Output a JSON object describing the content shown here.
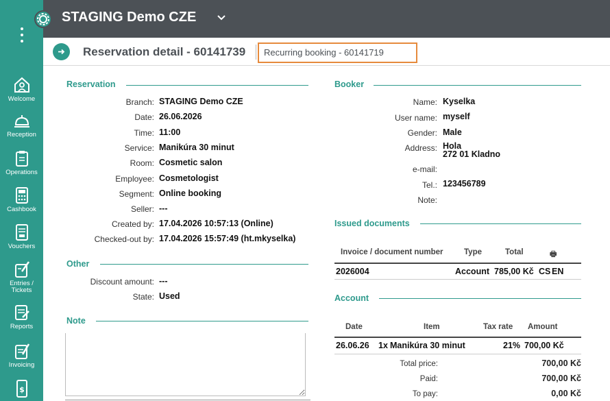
{
  "app": {
    "org_name": "STAGING Demo CZE"
  },
  "sidebar": {
    "items": [
      {
        "label": "Welcome",
        "icon": "house-person-icon"
      },
      {
        "label": "Reception",
        "icon": "reception-bell-icon"
      },
      {
        "label": "Operations",
        "icon": "clipboard-icon"
      },
      {
        "label": "Cashbook",
        "icon": "calculator-icon"
      },
      {
        "label": "Vouchers",
        "icon": "voucher-icon"
      },
      {
        "label": "Entries / Tickets",
        "icon": "ticket-icon"
      },
      {
        "label": "Reports",
        "icon": "report-icon"
      },
      {
        "label": "Invoicing",
        "icon": "invoice-icon"
      },
      {
        "label": "",
        "icon": "dollar-phone-icon"
      }
    ]
  },
  "header": {
    "page_title": "Reservation detail - 60141739",
    "recurring_booking": "Recurring booking - 60141719"
  },
  "reservation": {
    "title": "Reservation",
    "fields": [
      {
        "label": "Branch:",
        "value": "STAGING Demo CZE"
      },
      {
        "label": "Date:",
        "value": "26.06.2026"
      },
      {
        "label": "Time:",
        "value": "11:00"
      },
      {
        "label": "Service:",
        "value": "Manikúra 30 minut"
      },
      {
        "label": "Room:",
        "value": "Cosmetic salon"
      },
      {
        "label": "Employee:",
        "value": "Cosmetologist"
      },
      {
        "label": "Segment:",
        "value": "Online booking"
      },
      {
        "label": "Seller:",
        "value": "---"
      },
      {
        "label": "Created by:",
        "value": "17.04.2026 10:57:13 (Online)"
      },
      {
        "label": "Checked-out by:",
        "value": "17.04.2026 15:57:49 (ht.mkyselka)"
      }
    ]
  },
  "other": {
    "title": "Other",
    "fields": [
      {
        "label": "Discount amount:",
        "value": "---"
      },
      {
        "label": "State:",
        "value": "Used"
      }
    ]
  },
  "note": {
    "title": "Note",
    "value": ""
  },
  "booker": {
    "title": "Booker",
    "name_label": "Name:",
    "name": "Kyselka",
    "username_label": "User name:",
    "username": "myself",
    "gender_label": "Gender:",
    "gender": "Male",
    "address_label": "Address:",
    "address_line1": "Hola",
    "address_line2": "272 01 Kladno",
    "email_label": "e-mail:",
    "email": "",
    "tel_label": "Tel.:",
    "tel": "123456789",
    "note_label": "Note:",
    "note": ""
  },
  "issued_documents": {
    "title": "Issued documents",
    "columns": [
      "Invoice / document number",
      "Type",
      "Total",
      "🖶"
    ],
    "rows": [
      {
        "number": "2026004",
        "type": "Account",
        "total": "785,00 Kč",
        "lang_cs": "CS",
        "lang_en": "EN"
      }
    ]
  },
  "account": {
    "title": "Account",
    "columns": [
      "Date",
      "Item",
      "Tax rate",
      "Amount"
    ],
    "rows": [
      {
        "date": "26.06.26",
        "qty": "1x",
        "item": "Manikúra 30 minut",
        "tax": "21%",
        "amount": "700,00 Kč"
      }
    ],
    "totals": [
      {
        "label": "Total price:",
        "value": "700,00 Kč"
      },
      {
        "label": "Paid:",
        "value": "700,00 Kč"
      },
      {
        "label": "To pay:",
        "value": "0,00 Kč"
      }
    ]
  }
}
